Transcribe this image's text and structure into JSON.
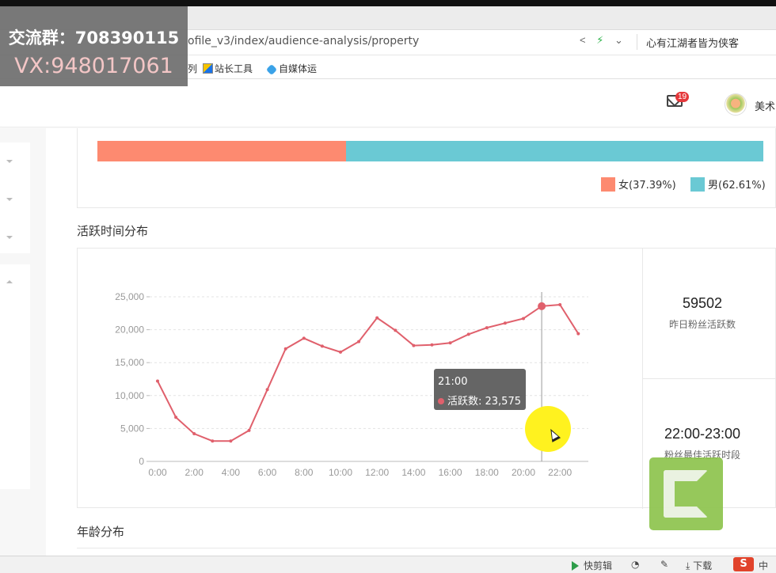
{
  "browser": {
    "url": "ofile_v3/index/audience-analysis/property",
    "profile_name": "心有江湖者皆为侠客",
    "bookmarks": [
      {
        "label": "列"
      },
      {
        "label": "站长工具"
      },
      {
        "label": "自媒体运"
      }
    ]
  },
  "header": {
    "mail_count": "19",
    "username": "美术"
  },
  "watermark": {
    "line1": "交流群：708390115",
    "line2": "VX:948017061"
  },
  "gender": {
    "female_label": "女(37.39%)",
    "male_label": "男(62.61%)",
    "female_pct": 37.39,
    "male_pct": 62.61,
    "colors": {
      "female": "#fd8a70",
      "male": "#6ac9d4"
    }
  },
  "activity": {
    "title": "活跃时间分布",
    "tooltip_time": "21:00",
    "tooltip_label": "活跃数: 23,575",
    "stats": {
      "value1": "59502",
      "label1": "昨日粉丝活跃数",
      "value2": "22:00-23:00",
      "label2": "粉丝最佳活跃时段"
    }
  },
  "age_section": {
    "title": "年龄分布"
  },
  "taskbar": {
    "item1": "快剪辑",
    "item2": "下载",
    "ime": "中"
  },
  "chart_data": {
    "type": "line",
    "x": [
      "0:00",
      "1:00",
      "2:00",
      "3:00",
      "4:00",
      "5:00",
      "6:00",
      "7:00",
      "8:00",
      "9:00",
      "10:00",
      "11:00",
      "12:00",
      "13:00",
      "14:00",
      "15:00",
      "16:00",
      "17:00",
      "18:00",
      "19:00",
      "20:00",
      "21:00",
      "22:00",
      "23:00"
    ],
    "x_tick_labels": [
      "0:00",
      "2:00",
      "4:00",
      "6:00",
      "8:00",
      "10:00",
      "12:00",
      "14:00",
      "16:00",
      "18:00",
      "20:00",
      "22:00"
    ],
    "series": [
      {
        "name": "活跃数",
        "values": [
          12200,
          6700,
          4200,
          3100,
          3100,
          4700,
          10900,
          17100,
          18700,
          17500,
          16600,
          18200,
          21800,
          19900,
          17600,
          17700,
          18000,
          19300,
          20300,
          21000,
          21700,
          23575,
          23800,
          19400
        ]
      }
    ],
    "ylim": [
      0,
      25000
    ],
    "y_ticks": [
      0,
      5000,
      10000,
      15000,
      20000,
      25000
    ],
    "y_tick_labels": [
      "0",
      "5,000",
      "10,000",
      "15,000",
      "20,000",
      "25,000"
    ],
    "highlight_index": 21,
    "grid": true,
    "line_color": "#e0606c"
  }
}
